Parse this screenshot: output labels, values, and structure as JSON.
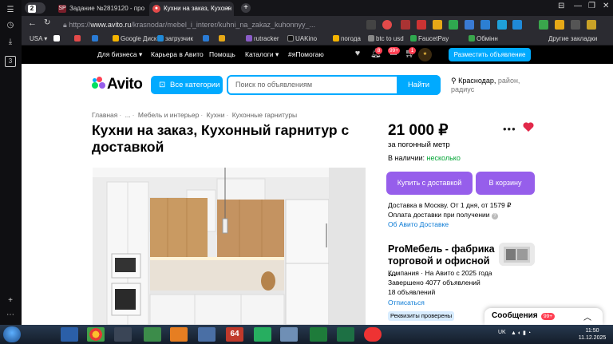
{
  "browser": {
    "tab_count": "2",
    "tabs": [
      {
        "label": "Задание №2819120 - про",
        "icon": "sp-favicon"
      },
      {
        "label": "Кухни на заказ, Кухонн",
        "icon": "avito-favicon"
      }
    ],
    "url_prefix": "https://",
    "url_host": "www.avito.ru",
    "url_path": "/krasnodar/mebel_i_interer/kuhni_na_zakaz_kuhonnyy_...",
    "bookmarks": [
      "USA",
      "Google Диск",
      "загрузчик",
      "rutracker",
      "UAKino",
      "погода",
      "btc to usd",
      "FaucetPay",
      "Обмінн",
      "Другие закладки"
    ]
  },
  "avito_nav": {
    "links": [
      "Для бизнеса",
      "Карьера в Авито",
      "Помощь",
      "Каталоги",
      "#яПомогаю"
    ],
    "notif_badge": "8",
    "chat_badge": "99+",
    "cart_badge": "1",
    "post_button": "Разместить объявление"
  },
  "header": {
    "logo": "Avito",
    "categories_button": "Все категории",
    "search_placeholder": "Поиск по объявлениям",
    "search_button": "Найти",
    "location_city": "Краснодар,",
    "location_rest": "район, радиус"
  },
  "breadcrumbs": [
    "Главная",
    "...",
    "Мебель и интерьер",
    "Кухни",
    "Кухонные гарнитуры"
  ],
  "listing": {
    "title": "Кухни на заказ, Кухонный гарнитур с доставкой",
    "price": "21 000 ₽",
    "price_unit": "за погонный метр",
    "stock_label": "В наличии:",
    "stock_value": "несколько",
    "buy_delivery_button": "Купить с доставкой",
    "cart_button": "В корзину",
    "delivery_line": "Доставка в Москву. От 1 дня, от 1579 ₽",
    "delivery_payment": "Оплата доставки при получении",
    "delivery_link": "Об Авито Доставке"
  },
  "seller": {
    "name": "ProМебель - фабрика торговой и офисной ...",
    "meta": "Компания · На Авито с 2025 года",
    "completed": "Завершено 4077 объявлений",
    "active": "18 объявлений",
    "unsubscribe": "Отписаться",
    "verified": "Реквизиты проверены"
  },
  "messages": {
    "label": "Сообщения",
    "count": "99+"
  },
  "taskbar": {
    "lang": "UK",
    "time": "11:50",
    "date": "11.12.2025",
    "app64": "64"
  },
  "colors": {
    "avito_blue": "#00aaff",
    "avito_purple": "#965eeb",
    "badge_red": "#ff4053",
    "stock_green": "#02a535",
    "link_blue": "#0a7ad5"
  }
}
